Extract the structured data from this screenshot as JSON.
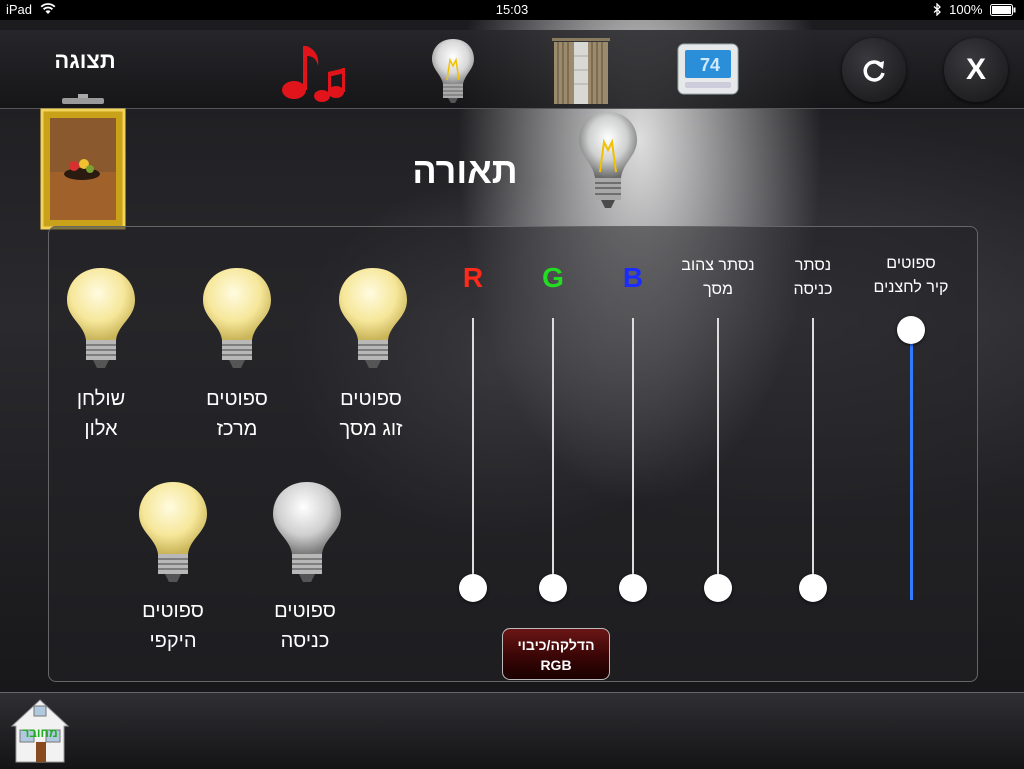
{
  "status_bar": {
    "device": "iPad",
    "time": "15:03",
    "battery": "100%",
    "wifi_icon": "wifi-icon",
    "bluetooth_icon": "bluetooth-icon"
  },
  "top_bar": {
    "display_label": "תצוגה",
    "icons": [
      "music-notes-icon",
      "light-bulb-icon",
      "curtains-icon",
      "thermostat-icon"
    ],
    "thermostat_display": "74",
    "refresh_icon": "refresh-icon",
    "close_label": "X"
  },
  "section": {
    "title": "תאורה",
    "icon": "light-bulb-icon"
  },
  "bulbs": [
    {
      "line1": "שולחן",
      "line2": "אלון",
      "state": "on"
    },
    {
      "line1": "ספוטים",
      "line2": "מרכז",
      "state": "on"
    },
    {
      "line1": "ספוטים",
      "line2": "זוג מסך",
      "state": "on"
    },
    {
      "line1": "ספוטים",
      "line2": "היקפי",
      "state": "on"
    },
    {
      "line1": "ספוטים",
      "line2": "כניסה",
      "state": "off"
    }
  ],
  "sliders": [
    {
      "label": "R",
      "color": "#ff2a1a",
      "level": 0
    },
    {
      "label": "G",
      "color": "#22dd22",
      "level": 0
    },
    {
      "label": "B",
      "color": "#1a2cff",
      "level": 0
    },
    {
      "line1": "נסתר צהוב",
      "line2": "מסך",
      "level": 0
    },
    {
      "line1": "נסתר",
      "line2": "כניסה",
      "level": 0
    },
    {
      "line1": "ספוטים",
      "line2": "קיר לחצנים",
      "level": 1,
      "fill_color": "#2f7cff"
    }
  ],
  "rgb_button": {
    "line1": "הדלקה/כיבוי",
    "line2": "RGB"
  },
  "home": {
    "label": "מחובר",
    "icon": "house-icon"
  }
}
